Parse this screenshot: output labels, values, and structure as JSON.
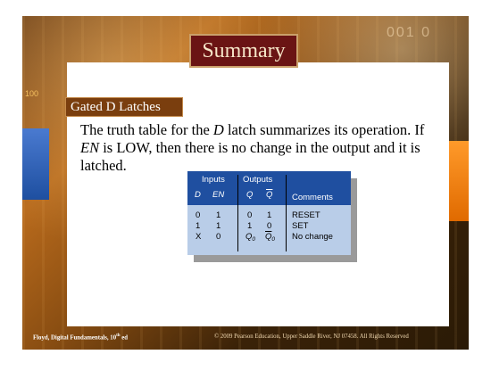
{
  "title": "Summary",
  "heading": "Gated D Latches",
  "paragraph": {
    "p1": "The truth table for the ",
    "p2": "D",
    "p3": " latch summarizes its operation. If ",
    "p4": "EN",
    "p5": " is LOW, then there is no change in the output and it is latched."
  },
  "decor": {
    "left_number": "100",
    "right_number": "001 0"
  },
  "truth_table": {
    "group_inputs": "Inputs",
    "group_outputs": "Outputs",
    "col_d": "D",
    "col_en": "EN",
    "col_q": "Q",
    "col_qbar": "Q",
    "col_comments": "Comments",
    "rows": [
      {
        "d": "0",
        "en": "1",
        "q": "0",
        "qbar": "1",
        "comment": "RESET"
      },
      {
        "d": "1",
        "en": "1",
        "q": "1",
        "qbar": "0",
        "comment": "SET"
      },
      {
        "d": "X",
        "en": "0",
        "q": "Q",
        "q_sub": "0",
        "qbar": "Q",
        "qbar_sub": "0",
        "comment": "No change"
      }
    ]
  },
  "footer": {
    "left_pre": "Floyd, Digital Fundamentals, 10",
    "left_sup": "th",
    "left_post": " ed",
    "right": "© 2009 Pearson Education, Upper Saddle River, NJ 07458. All Rights Reserved"
  }
}
